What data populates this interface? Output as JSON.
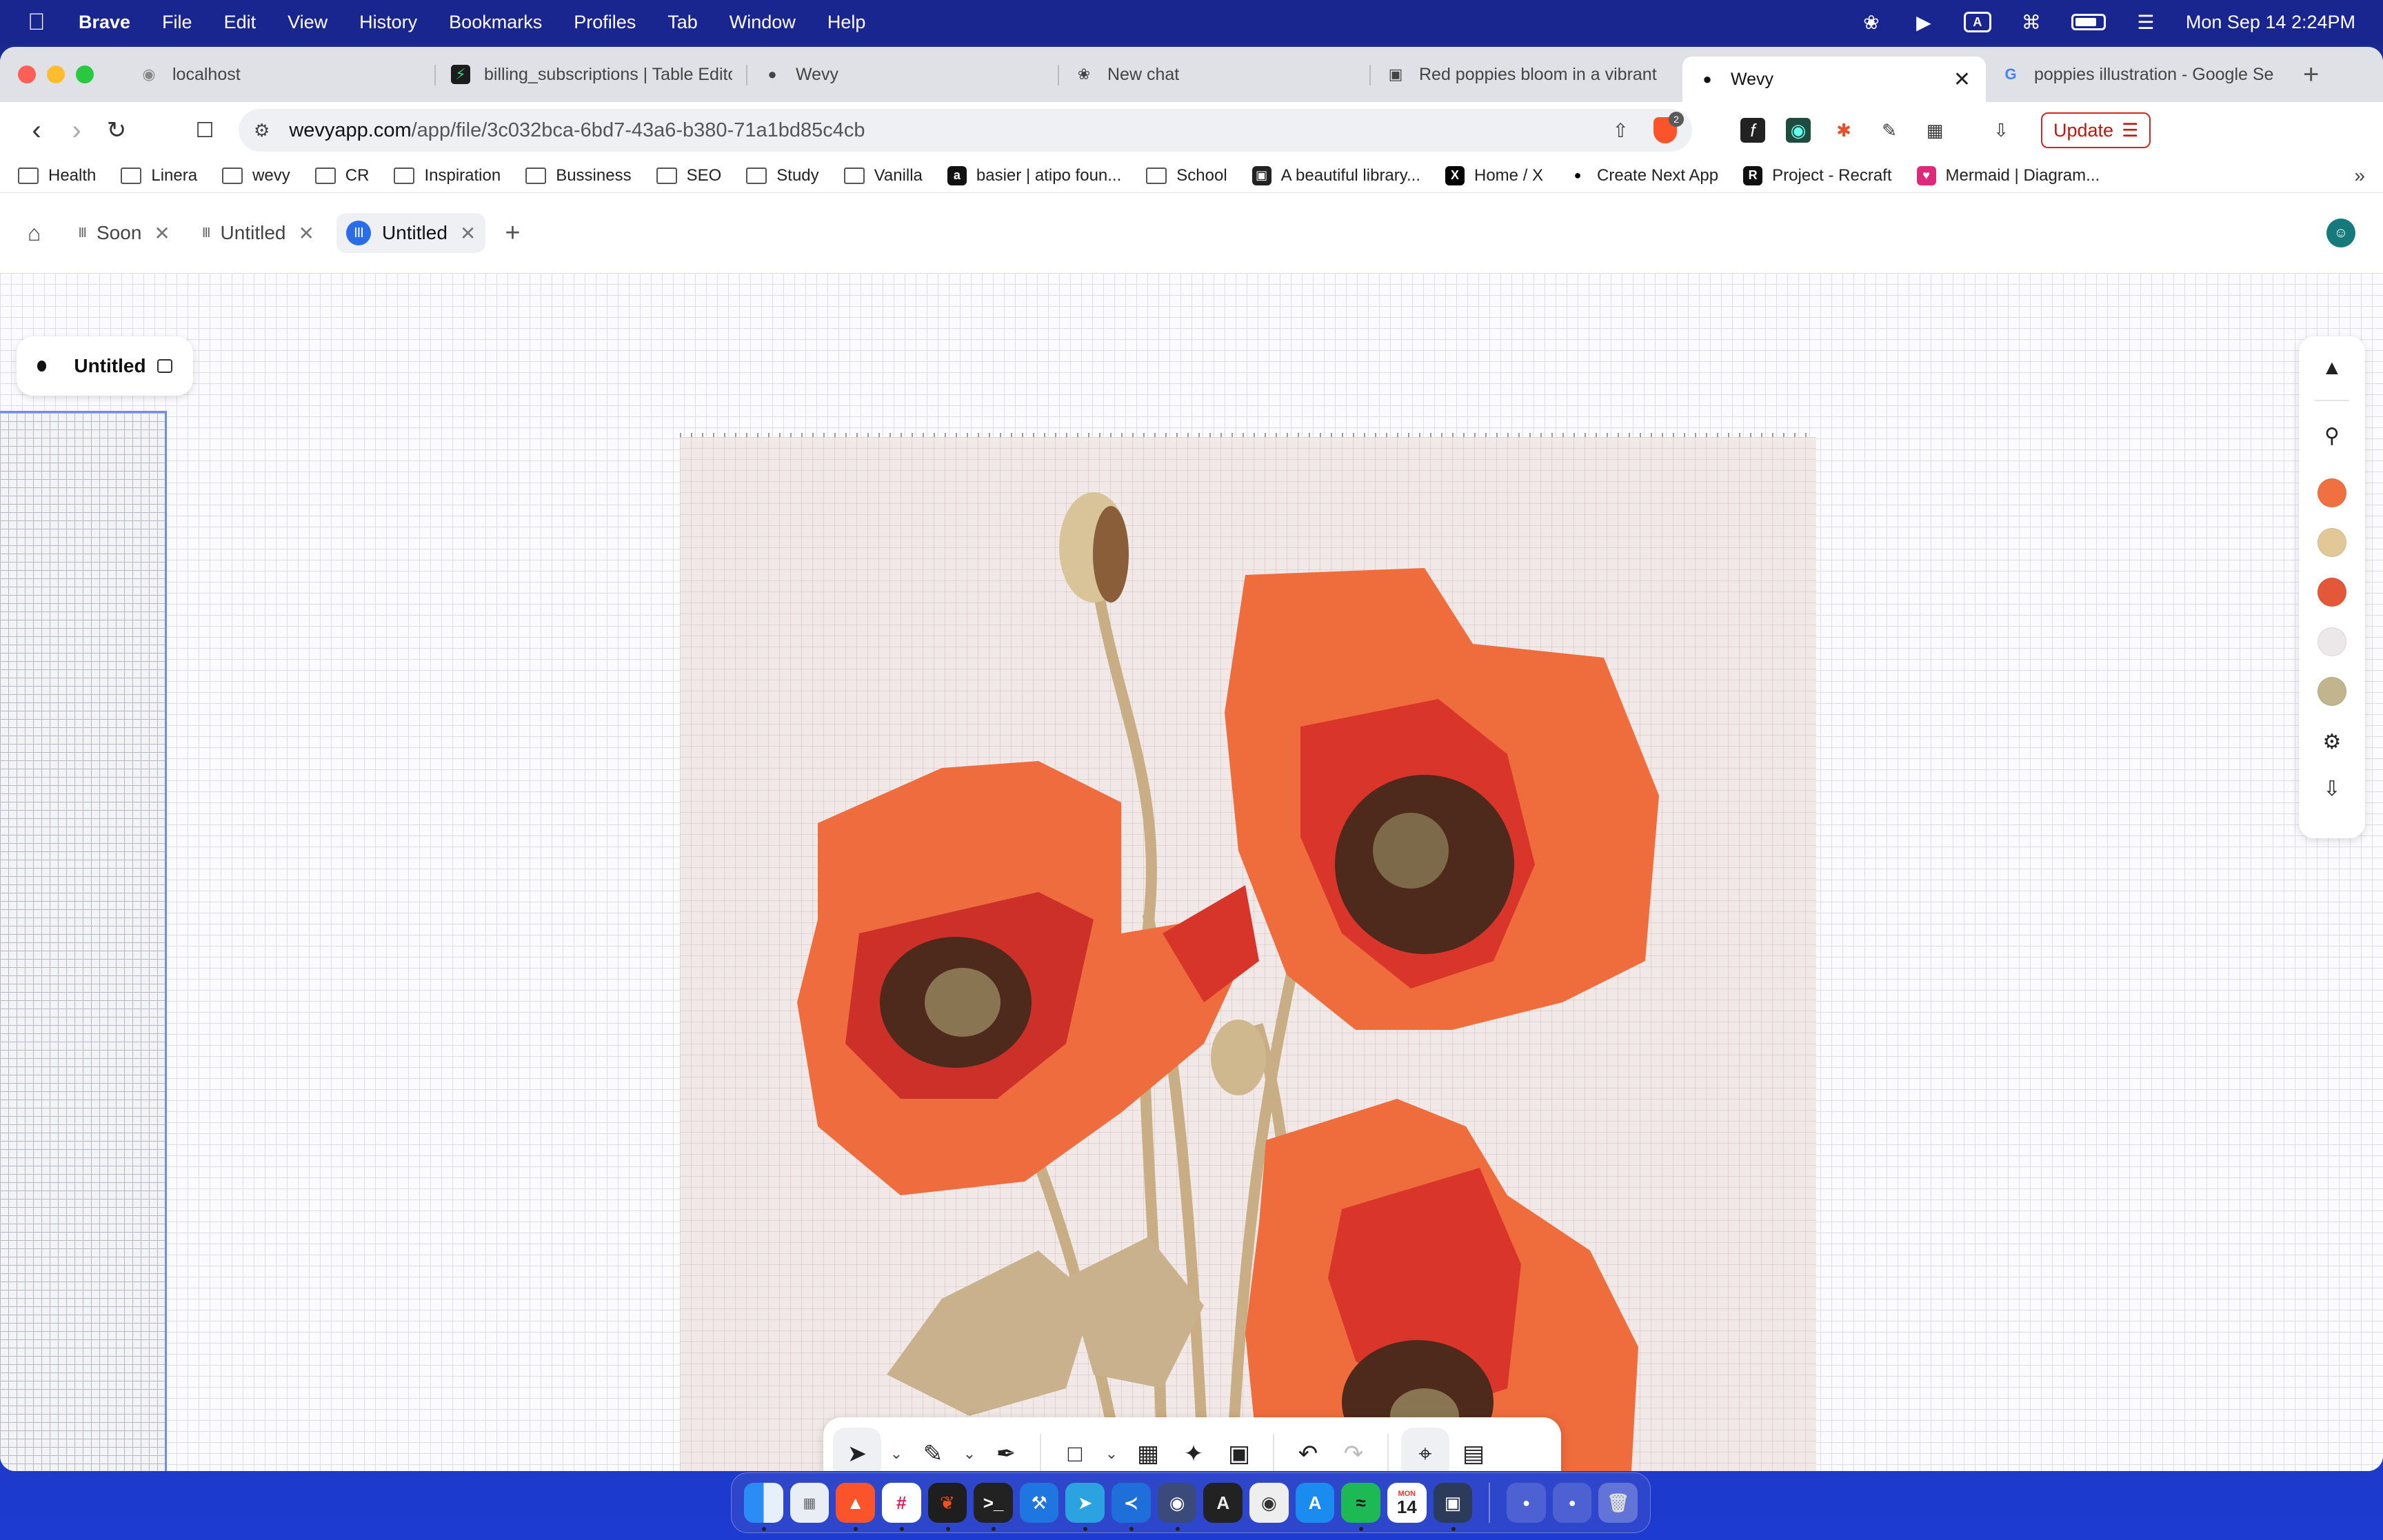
{
  "menubar": {
    "app_name": "Brave",
    "menus": [
      "File",
      "Edit",
      "View",
      "History",
      "Bookmarks",
      "Profiles",
      "Tab",
      "Window",
      "Help"
    ],
    "input_badge": "A",
    "datetime": "Mon Sep 14  2:24PM"
  },
  "browser": {
    "tabs": [
      {
        "label": "localhost",
        "icon": "globe-icon"
      },
      {
        "label": "billing_subscriptions | Table Editor",
        "icon": "supabase-icon"
      },
      {
        "label": "Wevy",
        "icon": "dot-icon"
      },
      {
        "label": "New chat",
        "icon": "openai-icon"
      },
      {
        "label": "Red poppies bloom in a vibrant",
        "icon": "unsplash-icon"
      },
      {
        "label": "Wevy",
        "icon": "dot-icon",
        "active": true
      },
      {
        "label": "poppies illustration - Google Search",
        "icon": "google-icon"
      }
    ],
    "url_host": "wevyapp.com",
    "url_path": "/app/file/3c032bca-6bd7-43a6-b380-71a1bd85c4cb",
    "shield_count": "2",
    "update_label": "Update",
    "bookmarks": [
      {
        "label": "Health",
        "type": "folder"
      },
      {
        "label": "Linera",
        "type": "folder"
      },
      {
        "label": "wevy",
        "type": "folder"
      },
      {
        "label": "CR",
        "type": "folder"
      },
      {
        "label": "Inspiration",
        "type": "folder"
      },
      {
        "label": "Bussiness",
        "type": "folder"
      },
      {
        "label": "SEO",
        "type": "folder"
      },
      {
        "label": "Study",
        "type": "folder"
      },
      {
        "label": "Vanilla",
        "type": "folder"
      },
      {
        "label": "basier | atipo foun...",
        "type": "site",
        "color": "#111111",
        "glyph": "a"
      },
      {
        "label": "School",
        "type": "folder"
      },
      {
        "label": "A beautiful library...",
        "type": "site",
        "color": "#222222",
        "glyph": "▣"
      },
      {
        "label": "Home / X",
        "type": "site",
        "color": "#000000",
        "glyph": "X"
      },
      {
        "label": "Create Next App",
        "type": "site",
        "color": "#ffffff",
        "glyph": "●"
      },
      {
        "label": "Project - Recraft",
        "type": "site",
        "color": "#111111",
        "glyph": "R"
      },
      {
        "label": "Mermaid | Diagram...",
        "type": "site",
        "color": "#e0287a",
        "glyph": "♥"
      }
    ]
  },
  "app": {
    "tabs": [
      {
        "label": "Soon",
        "active": false
      },
      {
        "label": "Untitled",
        "active": false
      },
      {
        "label": "Untitled",
        "active": true
      }
    ],
    "file_name": "Untitled",
    "palette": [
      "#f07040",
      "#e2c797",
      "#e4583a",
      "#ece8ea",
      "#c2b58d"
    ],
    "tools": [
      "select",
      "pen",
      "brush",
      "rectangle",
      "image-grid",
      "ai-sparkle",
      "image",
      "undo",
      "redo",
      "components",
      "layers"
    ]
  },
  "dock": {
    "calendar_month": "MON",
    "calendar_day": "14",
    "apps": [
      "finder",
      "launchpad",
      "brave",
      "slack",
      "figma",
      "terminal",
      "xcode",
      "telegram",
      "vscode",
      "proxyman",
      "arc",
      "screenshot",
      "appstore",
      "spotify",
      "calendar",
      "simulator"
    ]
  }
}
